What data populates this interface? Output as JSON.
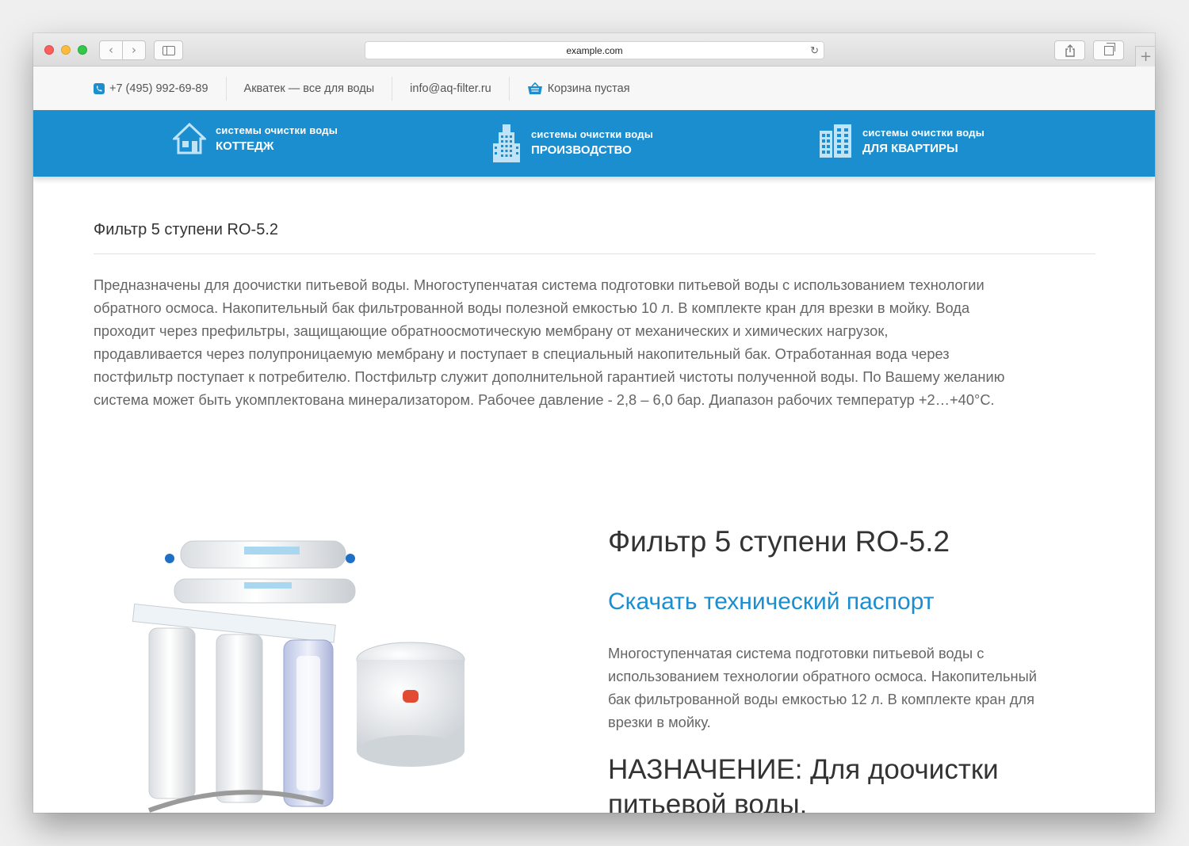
{
  "browser": {
    "url": "example.com",
    "back_glyph": "‹",
    "forward_glyph": "›",
    "reload_glyph": "↻",
    "newtab_glyph": "+",
    "share_glyph": "⇧"
  },
  "infobar": {
    "phone": "+7 (495) 992-69-89",
    "tagline": "Акватек — все для воды",
    "email": "info@aq-filter.ru",
    "cart": "Корзина пустая"
  },
  "nav": {
    "items": [
      {
        "small": "системы очистки воды",
        "big": "КОТТЕДЖ",
        "icon": "house-icon"
      },
      {
        "small": "системы очистки воды",
        "big": "ПРОИЗВОДСТВО",
        "icon": "factory-icon"
      },
      {
        "small": "системы очистки воды",
        "big": "ДЛЯ КВАРТИРЫ",
        "icon": "building-icon"
      }
    ]
  },
  "page": {
    "title": "Фильтр 5 ступени RO-5.2",
    "description_lines": [
      "Предназначены для доочистки питьевой воды. Многоступенчатая система подготовки питьевой воды с использованием технологии",
      "обратного осмоса. Накопительный бак фильтрованной воды полезной емкостью 10 л. В комплекте кран для врезки в мойку. Вода",
      "проходит через префильтры, защищающие обратноосмотическую мембрану от механических и химических нагрузок,",
      "продавливается через полупроницаемую мембрану и поступает в специальный накопительный бак. Отработанная вода через",
      "постфильтр поступает к потребителю. Постфильтр служит дополнительной гарантией чистоты полученной воды. По Вашему желанию",
      "система может быть укомплектована минерализатором. Рабочее давление - 2,8 – 6,0 бар. Диапазон рабочих температур +2…+40°С."
    ]
  },
  "product": {
    "title": "Фильтр 5 ступени RO-5.2",
    "download_link": "Скачать технический паспорт",
    "description_lines": [
      "Многоступенчатая система подготовки питьевой воды с",
      "использованием технологии обратного осмоса. Накопительный",
      "бак фильтрованной воды емкостью 12 л. В комплекте кран для",
      "врезки в мойку."
    ],
    "purpose_lines": [
      "НАЗНАЧЕНИЕ: Для доочистки",
      "питьевой воды."
    ]
  },
  "colors": {
    "brand_blue": "#1b8ed0",
    "text_dark": "#333333",
    "text_muted": "#666666"
  }
}
